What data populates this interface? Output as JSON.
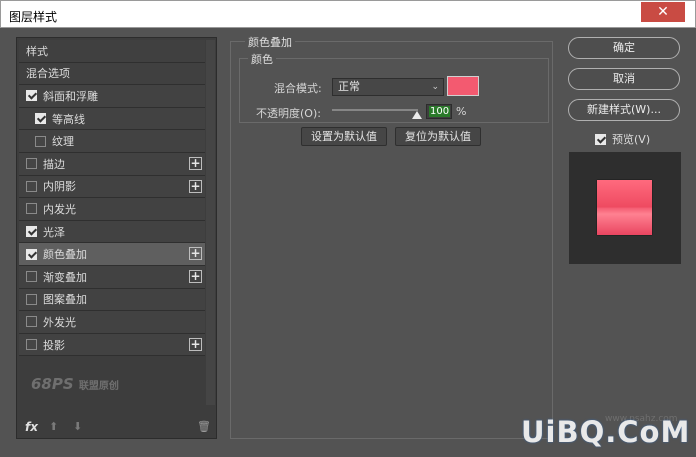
{
  "window": {
    "title": "图层样式",
    "close_glyph": "✕"
  },
  "left_panel": {
    "items": [
      {
        "label": "样式",
        "checkbox": null,
        "plus": false,
        "indent": 0,
        "selected": false
      },
      {
        "label": "混合选项",
        "checkbox": null,
        "plus": false,
        "indent": 0,
        "selected": false
      },
      {
        "label": "斜面和浮雕",
        "checkbox": true,
        "plus": false,
        "indent": 0,
        "selected": false
      },
      {
        "label": "等高线",
        "checkbox": true,
        "plus": false,
        "indent": 1,
        "selected": false
      },
      {
        "label": "纹理",
        "checkbox": false,
        "plus": false,
        "indent": 1,
        "selected": false
      },
      {
        "label": "描边",
        "checkbox": false,
        "plus": true,
        "indent": 0,
        "selected": false
      },
      {
        "label": "内阴影",
        "checkbox": false,
        "plus": true,
        "indent": 0,
        "selected": false
      },
      {
        "label": "内发光",
        "checkbox": false,
        "plus": false,
        "indent": 0,
        "selected": false
      },
      {
        "label": "光泽",
        "checkbox": true,
        "plus": false,
        "indent": 0,
        "selected": false
      },
      {
        "label": "颜色叠加",
        "checkbox": true,
        "plus": true,
        "indent": 0,
        "selected": true
      },
      {
        "label": "渐变叠加",
        "checkbox": false,
        "plus": true,
        "indent": 0,
        "selected": false
      },
      {
        "label": "图案叠加",
        "checkbox": false,
        "plus": false,
        "indent": 0,
        "selected": false
      },
      {
        "label": "外发光",
        "checkbox": false,
        "plus": false,
        "indent": 0,
        "selected": false
      },
      {
        "label": "投影",
        "checkbox": false,
        "plus": true,
        "indent": 0,
        "selected": false
      }
    ],
    "watermark": "68PS",
    "watermark_sub": "联盟原创",
    "fx_label": "fx",
    "plus_glyph": "+",
    "up_glyph": "⬆",
    "down_glyph": "⬇",
    "trash_glyph": "🗑"
  },
  "overlay": {
    "section_title": "颜色叠加",
    "group_title": "颜色",
    "blend_mode_label": "混合模式:",
    "blend_mode_value": "正常",
    "chevron_glyph": "⌄",
    "overlay_color": "#f35a70",
    "opacity_label": "不透明度(O):",
    "opacity_value": "100",
    "opacity_unit": "%",
    "opacity_fraction": 1.0,
    "set_default": "设置为默认值",
    "reset_default": "复位为默认值"
  },
  "right": {
    "ok": "确定",
    "cancel": "取消",
    "new_style": "新建样式(W)...",
    "preview_label": "预览(V)",
    "preview_checked": true
  },
  "watermark_right": "UiBQ.CoM",
  "watermark_right_small": "www.psahz.com"
}
